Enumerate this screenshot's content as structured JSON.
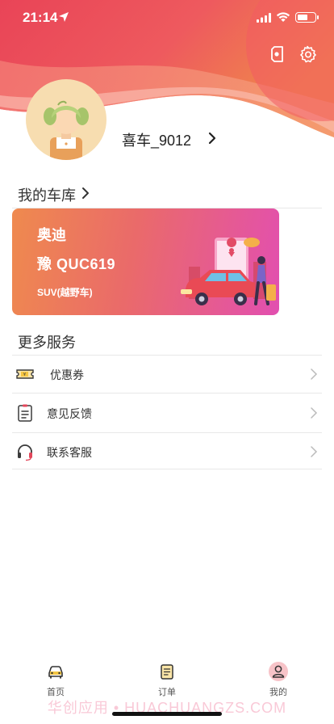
{
  "status_bar": {
    "time": "21:14",
    "battery_level": 0.6,
    "icons": [
      "location-arrow-icon",
      "signal-icon",
      "wifi-icon",
      "battery-icon"
    ]
  },
  "header": {
    "icons": [
      "share-icon",
      "gear-icon"
    ],
    "colors": {
      "primary": "#ea4a64",
      "secondary": "#f07a45"
    }
  },
  "profile": {
    "username": "喜车_9012"
  },
  "garage": {
    "title": "我的车库",
    "car": {
      "brand": "奥迪",
      "plate": "豫 QUC619",
      "type": "SUV(越野车)"
    }
  },
  "services": {
    "title": "更多服务",
    "items": [
      {
        "label": "优惠券",
        "icon": "coupon-icon"
      },
      {
        "label": "意见反馈",
        "icon": "clipboard-icon"
      },
      {
        "label": "联系客服",
        "icon": "headset-icon"
      }
    ]
  },
  "tab_bar": {
    "tabs": [
      {
        "label": "首页",
        "icon": "car-icon"
      },
      {
        "label": "订单",
        "icon": "order-icon"
      },
      {
        "label": "我的",
        "icon": "profile-icon",
        "active": true
      }
    ]
  },
  "watermark": "华创应用 • HUACHUANGZS.COM"
}
